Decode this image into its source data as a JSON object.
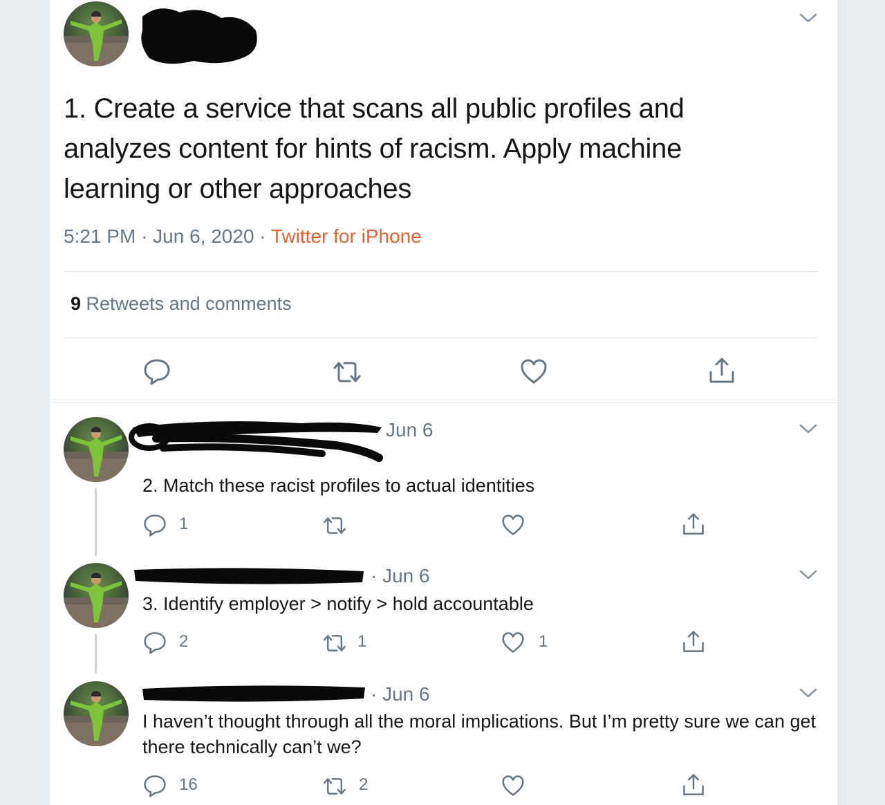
{
  "main_tweet": {
    "text": "1. Create a service that scans all public profiles and analyzes content for hints of racism. Apply machine learning or other approaches",
    "time": "5:21 PM",
    "sep1": "·",
    "date": "Jun 6, 2020",
    "sep2": "·",
    "source": "Twitter for iPhone",
    "stats_count": "9",
    "stats_label": "Retweets and comments"
  },
  "replies": [
    {
      "date": "Jun 6",
      "text": "2. Match these racist profiles to actual identities",
      "reply_count": "1",
      "retweet_count": "",
      "like_count": ""
    },
    {
      "date": "· Jun 6",
      "text": "3. Identify employer > notify > hold accountable",
      "reply_count": "2",
      "retweet_count": "1",
      "like_count": "1"
    },
    {
      "date": "· Jun 6",
      "text": "I haven’t thought through all the moral implications. But I’m pretty sure we can get there technically can’t we?",
      "reply_count": "16",
      "retweet_count": "2",
      "like_count": ""
    }
  ],
  "icons": {
    "reply": "reply-icon",
    "retweet": "retweet-icon",
    "like": "heart-icon",
    "share": "share-icon",
    "menu": "chevron-down-icon"
  },
  "colors": {
    "source_link": "#e0632f",
    "secondary_text": "#657786",
    "background": "#e6ecf0"
  }
}
